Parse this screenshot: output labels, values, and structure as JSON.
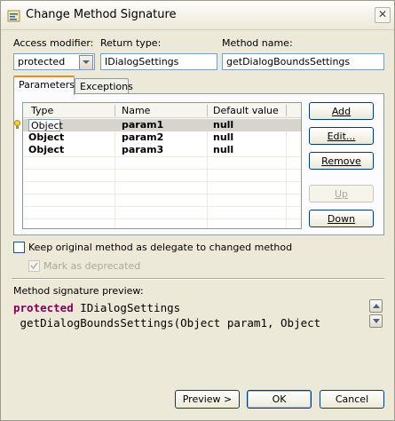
{
  "window": {
    "title": "Change Method Signature",
    "close_glyph": "✕"
  },
  "fields": {
    "access_modifier_label": "Access modifier:",
    "access_modifier_value": "protected",
    "return_type_label": "Return type:",
    "return_type_value": "IDialogSettings",
    "method_name_label": "Method name:",
    "method_name_value": "getDialogBoundsSettings"
  },
  "tabs": [
    {
      "label": "Parameters",
      "active": true
    },
    {
      "label": "Exceptions",
      "active": false
    }
  ],
  "table": {
    "headers": [
      "Type",
      "Name",
      "Default value"
    ],
    "rows": [
      {
        "type": "Object",
        "name": "param1",
        "default": "null",
        "selected": true
      },
      {
        "type": "Object",
        "name": "param2",
        "default": "null",
        "selected": false
      },
      {
        "type": "Object",
        "name": "param3",
        "default": "null",
        "selected": false
      }
    ]
  },
  "side_buttons": {
    "add": "Add",
    "edit": "Edit...",
    "remove": "Remove",
    "up": "Up",
    "down": "Down"
  },
  "options": {
    "keep_delegate_label": "Keep original method as delegate to changed method",
    "mark_deprecated_label": "Mark as deprecated"
  },
  "preview": {
    "label": "Method signature preview:",
    "keyword": "protected",
    "line1_rest": " IDialogSettings",
    "line2": " getDialogBoundsSettings(Object param1, Object"
  },
  "footer": {
    "preview_button": "Preview >",
    "ok_button": "OK",
    "cancel_button": "Cancel"
  },
  "colors": {
    "keyword": "#7f0055",
    "tab_highlight": "#e68b2c",
    "dialog_bg": "#ece9d8"
  }
}
